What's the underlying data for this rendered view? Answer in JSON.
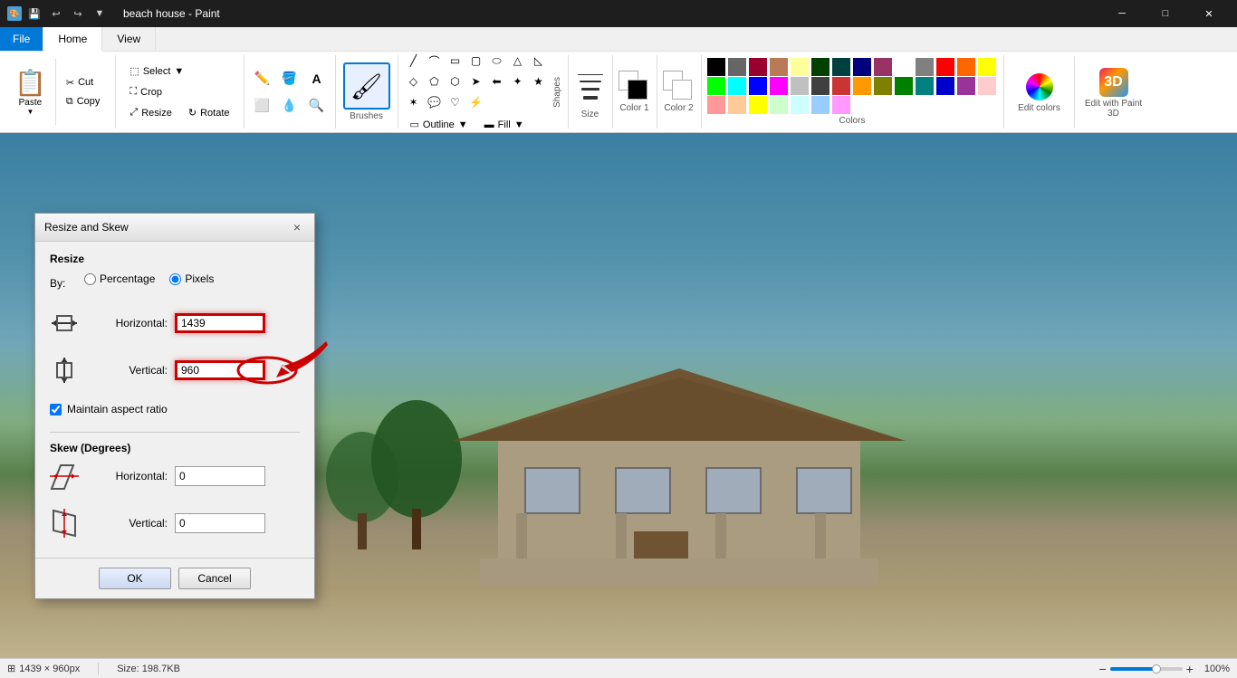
{
  "titleBar": {
    "title": "beach house - Paint",
    "quickAccess": [
      "save",
      "undo",
      "redo",
      "customize"
    ]
  },
  "ribbon": {
    "tabs": [
      "File",
      "Home",
      "View"
    ],
    "activeTab": "Home",
    "groups": {
      "clipboard": {
        "paste": "Paste",
        "cut": "Cut",
        "copy": "Copy",
        "paste2": "Paste"
      },
      "image": {
        "select": "Select",
        "crop": "Crop",
        "resize": "Resize",
        "rotate": "Rotate"
      },
      "shapes": {
        "outline": "Outline",
        "fill": "Fill",
        "label": "Shapes"
      },
      "size": {
        "label": "Size"
      },
      "color1": {
        "label": "Color 1"
      },
      "color2": {
        "label": "Color 2"
      },
      "colors": {
        "label": "Colors"
      },
      "editColors": {
        "label": "Edit colors"
      },
      "editWithPaint3D": {
        "label": "Edit with Paint 3D"
      }
    },
    "palette": [
      "#000000",
      "#666666",
      "#990030",
      "#b97a57",
      "#ffff99",
      "#004000",
      "#004040",
      "#00007f",
      "#993366",
      "#ffffff",
      "#808080",
      "#ff0000",
      "#ff6600",
      "#ffff00",
      "#00ff00",
      "#00ffff",
      "#0000ff",
      "#ff00ff",
      "#c0c0c0",
      "#404040",
      "#cc3333",
      "#ff9900",
      "#808000",
      "#008000",
      "#008080",
      "#0000cc",
      "#993399",
      "#ffcccc",
      "#ff9999",
      "#ffcc99",
      "#ffff00",
      "#ccffcc",
      "#ccffff",
      "#99ccff",
      "#ff99ff"
    ]
  },
  "dialog": {
    "title": "Resize and Skew",
    "close": "×",
    "resize": {
      "sectionTitle": "Resize",
      "by": "By:",
      "percentageLabel": "Percentage",
      "pixelsLabel": "Pixels",
      "selectedOption": "pixels",
      "horizontalLabel": "Horizontal:",
      "horizontalValue": "1439",
      "verticalLabel": "Vertical:",
      "verticalValue": "960",
      "maintainAspectRatio": "Maintain aspect ratio",
      "maintainChecked": true
    },
    "skew": {
      "sectionTitle": "Skew (Degrees)",
      "horizontalLabel": "Horizontal:",
      "horizontalValue": "0",
      "verticalLabel": "Vertical:",
      "verticalValue": "0"
    },
    "okLabel": "OK",
    "cancelLabel": "Cancel"
  },
  "statusBar": {
    "dimensions": "1439 × 960px",
    "fileSize": "Size: 198.7KB",
    "zoom": "100%"
  }
}
